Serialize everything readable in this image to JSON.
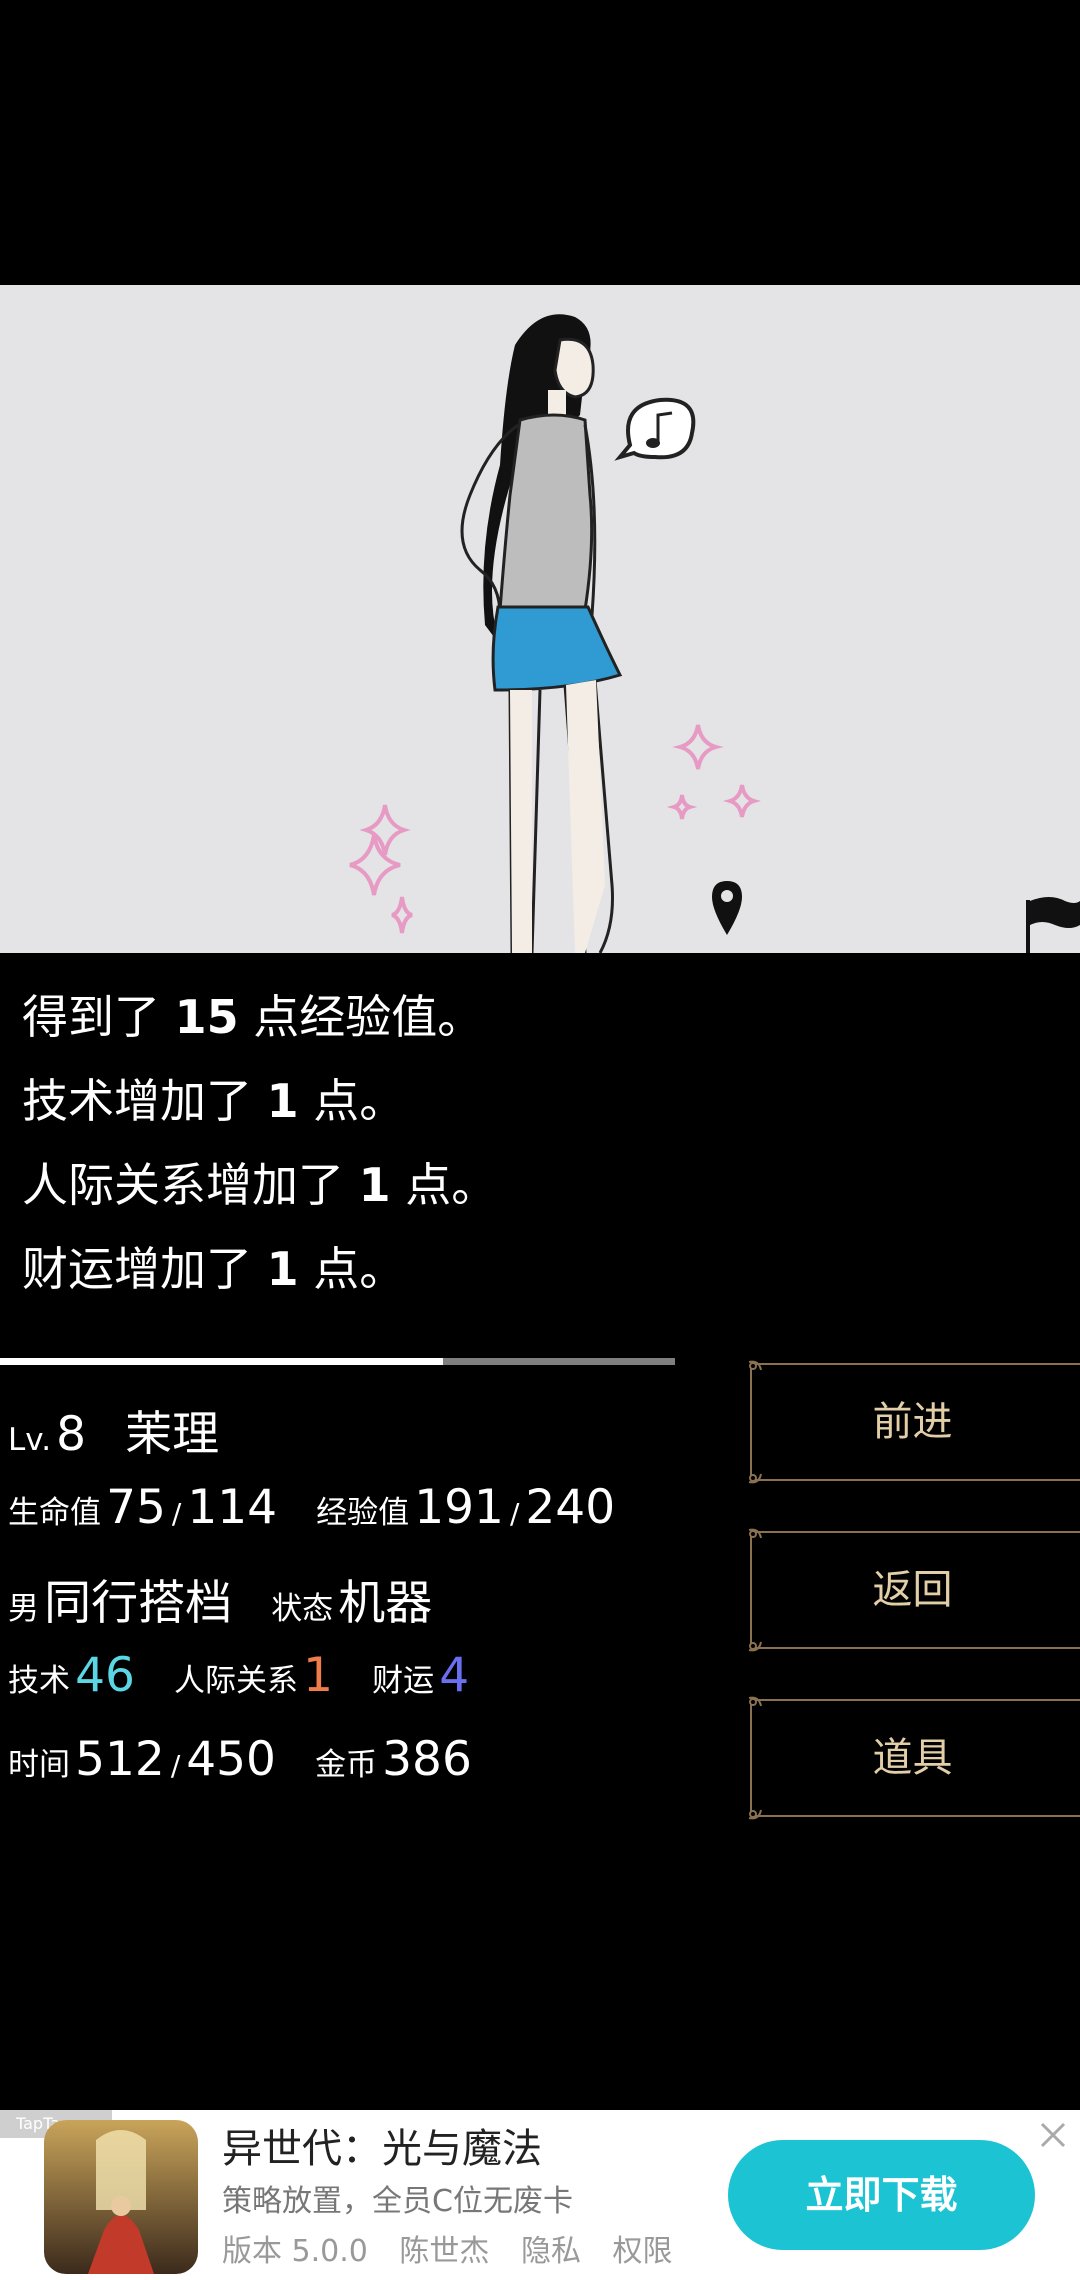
{
  "log": {
    "lines": [
      [
        "得到了 ",
        "15",
        " 点经验值。"
      ],
      [
        "技术增加了 ",
        "1",
        " 点。"
      ],
      [
        "人际关系增加了 ",
        "1",
        " 点。"
      ],
      [
        "财运增加了 ",
        "1",
        " 点。"
      ]
    ]
  },
  "progress": {
    "fraction": 0.656
  },
  "stats": {
    "level_label": "Lv.",
    "level": "8",
    "name": "茉理",
    "hp_label": "生命值",
    "hp": "75",
    "hp_max": "114",
    "exp_label": "经验值",
    "exp": "191",
    "exp_max": "240",
    "gender": "男",
    "role": "同行搭档",
    "status_label": "状态",
    "status": "机器",
    "skill_label": "技术",
    "skill": "46",
    "social_label": "人际关系",
    "social": "1",
    "fortune_label": "财运",
    "fortune": "4",
    "time_label": "时间",
    "time": "512",
    "time_max": "450",
    "gold_label": "金币",
    "gold": "386",
    "slash": "/"
  },
  "colors": {
    "skill": "#5ad6e4",
    "social": "#f07c4c",
    "fortune": "#6a6ef0",
    "button_text": "#e2cfa8",
    "button_border": "#8a7150",
    "download": "#1cc3d3"
  },
  "buttons": {
    "forward": "前进",
    "back": "返回",
    "items": "道具"
  },
  "scene": {
    "icons": [
      "music-note-speech-bubble-icon",
      "map-pin-icon",
      "flag-icon",
      "sparkle-icon"
    ]
  },
  "ad": {
    "tag": "TapTap",
    "title": "异世代：光与魔法",
    "description": "策略放置，全员C位无废卡",
    "version": "版本 5.0.0",
    "developer": "陈世杰",
    "privacy": "隐私",
    "permissions": "权限",
    "download": "立即下载"
  }
}
